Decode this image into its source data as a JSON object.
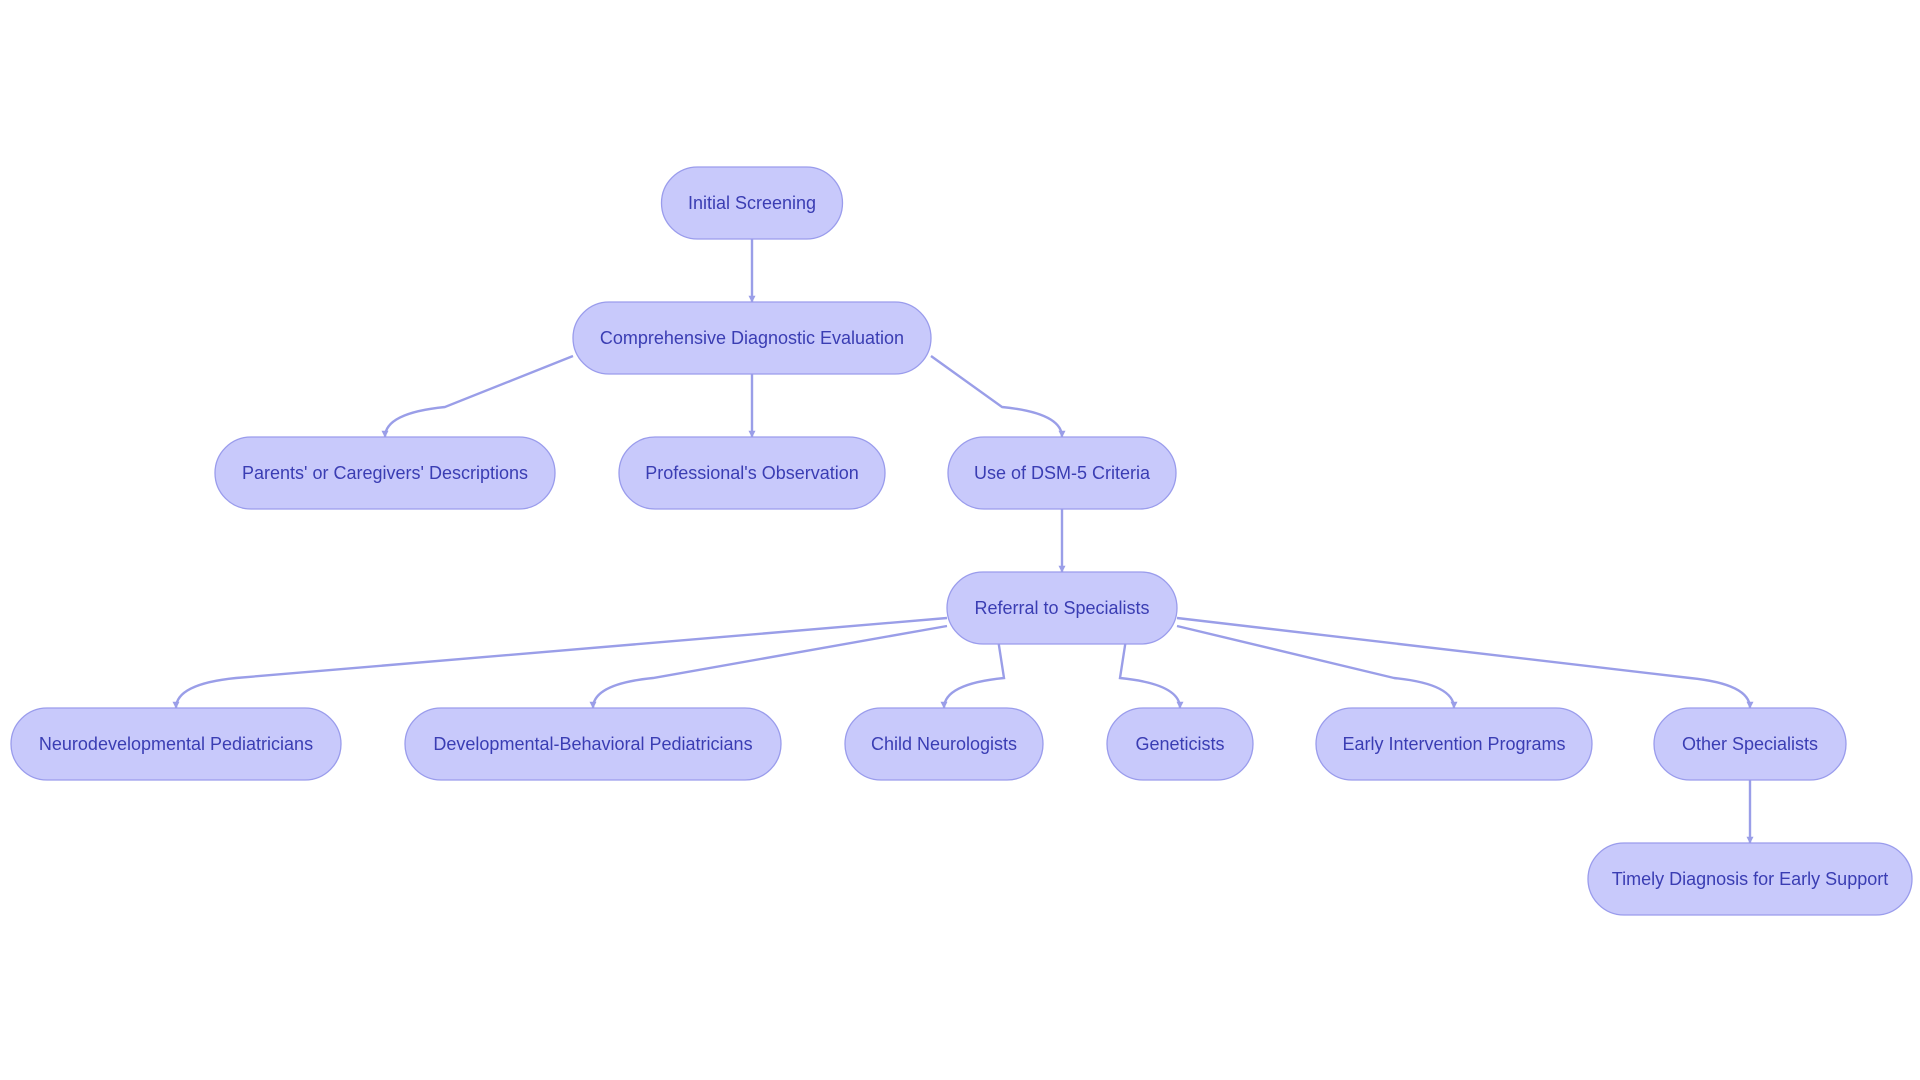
{
  "diagram": {
    "type": "flowchart",
    "direction": "top-down",
    "colors": {
      "node_fill": "#c8c9fb",
      "node_stroke": "#9a9cec",
      "node_text": "#3a3db3",
      "edge": "#9a9ee8",
      "background": "#ffffff"
    },
    "nodes": [
      {
        "id": "initial",
        "label": "Initial Screening"
      },
      {
        "id": "comprehensive",
        "label": "Comprehensive Diagnostic Evaluation"
      },
      {
        "id": "parents",
        "label": "Parents' or Caregivers' Descriptions"
      },
      {
        "id": "professional",
        "label": "Professional's Observation"
      },
      {
        "id": "dsm5",
        "label": "Use of DSM-5 Criteria"
      },
      {
        "id": "referral",
        "label": "Referral to Specialists"
      },
      {
        "id": "neurodev",
        "label": "Neurodevelopmental Pediatricians"
      },
      {
        "id": "devbehav",
        "label": "Developmental-Behavioral Pediatricians"
      },
      {
        "id": "childneuro",
        "label": "Child Neurologists"
      },
      {
        "id": "geneticists",
        "label": "Geneticists"
      },
      {
        "id": "earlyint",
        "label": "Early Intervention Programs"
      },
      {
        "id": "other",
        "label": "Other Specialists"
      },
      {
        "id": "timely",
        "label": "Timely Diagnosis for Early Support"
      }
    ],
    "edges": [
      {
        "from": "initial",
        "to": "comprehensive"
      },
      {
        "from": "comprehensive",
        "to": "parents"
      },
      {
        "from": "comprehensive",
        "to": "professional"
      },
      {
        "from": "comprehensive",
        "to": "dsm5"
      },
      {
        "from": "dsm5",
        "to": "referral"
      },
      {
        "from": "referral",
        "to": "neurodev"
      },
      {
        "from": "referral",
        "to": "devbehav"
      },
      {
        "from": "referral",
        "to": "childneuro"
      },
      {
        "from": "referral",
        "to": "geneticists"
      },
      {
        "from": "referral",
        "to": "earlyint"
      },
      {
        "from": "referral",
        "to": "other"
      },
      {
        "from": "other",
        "to": "timely"
      }
    ]
  }
}
